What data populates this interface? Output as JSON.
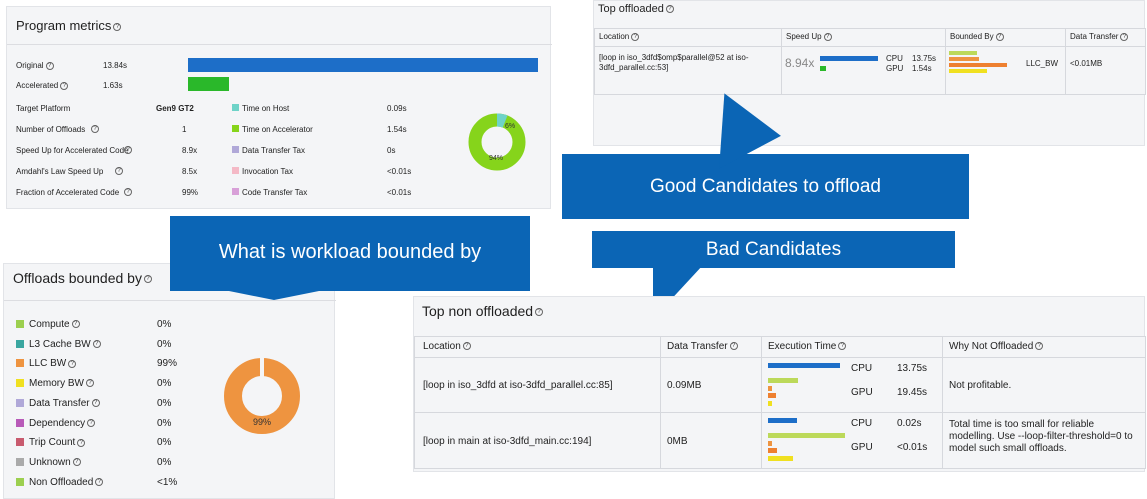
{
  "colors": {
    "accent": "#0b65b5",
    "bar_blue": "#1d6ec8",
    "bar_green": "#2ab82a",
    "donut_green": "#86d41b",
    "donut_orange": "#ee9440",
    "bar_lightgreen": "#bcd95a",
    "bar_yellow": "#f0e020"
  },
  "program_metrics": {
    "title": "Program metrics",
    "original_label": "Original",
    "original_value": "13.84s",
    "accelerated_label": "Accelerated",
    "accelerated_value": "1.63s",
    "original_fraction": 1.0,
    "accelerated_fraction": 0.118,
    "left_rows": [
      {
        "label": "Target Platform",
        "value": "Gen9 GT2"
      },
      {
        "label": "Number of Offloads",
        "value": "1"
      },
      {
        "label": "Speed Up for Accelerated Code",
        "value": "8.9x"
      },
      {
        "label": "Amdahl's Law Speed Up",
        "value": "8.5x"
      },
      {
        "label": "Fraction of Accelerated Code",
        "value": "99%"
      }
    ],
    "right_rows": [
      {
        "label": "Time on Host",
        "value": "0.09s",
        "color": "#6ed3c8"
      },
      {
        "label": "Time on Accelerator",
        "value": "1.54s",
        "color": "#86d41b"
      },
      {
        "label": "Data Transfer Tax",
        "value": "0s",
        "color": "#b0a8d8"
      },
      {
        "label": "Invocation Tax",
        "value": "<0.01s",
        "color": "#f4b9c6"
      },
      {
        "label": "Code Transfer Tax",
        "value": "<0.01s",
        "color": "#d8a0d8"
      }
    ],
    "donut": {
      "small_label": "6%",
      "large_label": "94%",
      "small_fraction": 0.06
    }
  },
  "top_offloaded": {
    "title": "Top offloaded",
    "headers": [
      "Location",
      "Speed Up",
      "Bounded By",
      "Data Transfer"
    ],
    "location": "[loop in iso_3dfd$omp$parallel@52 at iso-3dfd_parallel.cc:53]",
    "speedup": "8.94x",
    "cpu_label": "CPU",
    "cpu_value": "13.75s",
    "gpu_label": "GPU",
    "gpu_value": "1.54s",
    "bounded_label": "LLC_BW",
    "data_transfer": "<0.01MB"
  },
  "callouts": {
    "good": "Good Candidates to offload",
    "bad": "Bad Candidates",
    "workload": "What is workload bounded by"
  },
  "offloads_bounded": {
    "title": "Offloads bounded by",
    "items": [
      {
        "label": "Compute",
        "value": "0%",
        "color": "#9ccf4f"
      },
      {
        "label": "L3 Cache BW",
        "value": "0%",
        "color": "#3aa6a0"
      },
      {
        "label": "LLC BW",
        "value": "99%",
        "color": "#ee9440"
      },
      {
        "label": "Memory BW",
        "value": "0%",
        "color": "#f0e020"
      },
      {
        "label": "Data Transfer",
        "value": "0%",
        "color": "#b0a8d8"
      },
      {
        "label": "Dependency",
        "value": "0%",
        "color": "#b85ab8"
      },
      {
        "label": "Trip Count",
        "value": "0%",
        "color": "#c85a6e"
      },
      {
        "label": "Unknown",
        "value": "0%",
        "color": "#aaaaaa"
      },
      {
        "label": "Non Offloaded",
        "value": "<1%",
        "color": "#9ccf4f"
      }
    ],
    "donut_label": "99%"
  },
  "top_non_offloaded": {
    "title": "Top non offloaded",
    "headers": [
      "Location",
      "Data Transfer",
      "Execution Time",
      "Why Not Offloaded"
    ],
    "rows": [
      {
        "location": "[loop in iso_3dfd at iso-3dfd_parallel.cc:85]",
        "data_transfer": "0.09MB",
        "cpu_label": "CPU",
        "cpu_value": "13.75s",
        "gpu_label": "GPU",
        "gpu_value": "19.45s",
        "why": "Not profitable."
      },
      {
        "location": "[loop in main at iso-3dfd_main.cc:194]",
        "data_transfer": "0MB",
        "cpu_label": "CPU",
        "cpu_value": "0.02s",
        "gpu_label": "GPU",
        "gpu_value": "<0.01s",
        "why": "Total time is too small for reliable modelling. Use --loop-filter-threshold=0 to model such small offloads."
      }
    ]
  }
}
